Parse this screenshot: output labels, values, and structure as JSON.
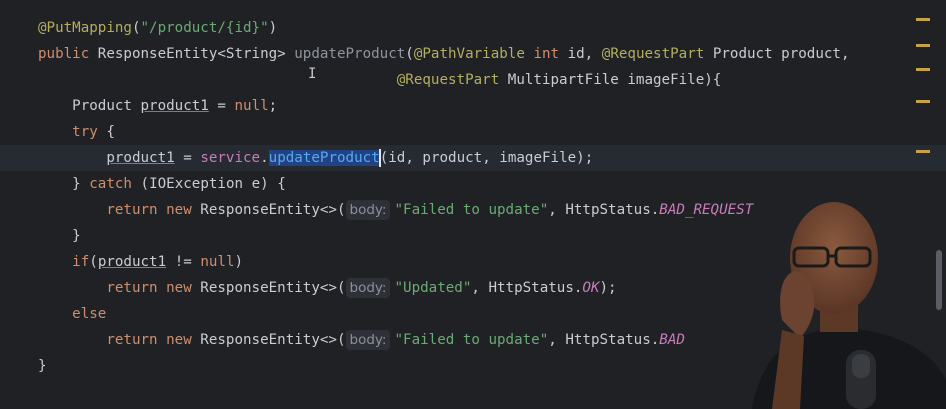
{
  "code": {
    "l1_annotation": "@PutMapping",
    "l1_open": "(",
    "l1_path": "\"/product/{id}\"",
    "l1_close": ")",
    "l2_public": "public",
    "l2_type": " ResponseEntity<String> ",
    "l2_method": "updateProduct",
    "l2_open": "(",
    "l2_anno1": "@PathVariable",
    "l2_sp1": " ",
    "l2_int": "int",
    "l2_id": " id, ",
    "l2_anno2": "@RequestPart",
    "l2_rest": " Product product,",
    "l3_indent": "                                          ",
    "l3_anno": "@RequestPart",
    "l3_rest": " MultipartFile imageFile){",
    "l5_indent": "    ",
    "l5_type": "Product ",
    "l5_var": "product1",
    "l5_eq": " = ",
    "l5_null": "null",
    "l5_semi": ";",
    "l6_indent": "    ",
    "l6_try": "try",
    "l6_brace": " {",
    "l7_indent": "        ",
    "l7_var": "product1",
    "l7_eq": " = ",
    "l7_service": "service",
    "l7_dot": ".",
    "l7_method_sel": "updateProduc",
    "l7_method_rest": "t",
    "l7_args": "(id, product, imageFile);",
    "l8_indent": "    ",
    "l8_close": "} ",
    "l8_catch": "catch",
    "l8_rest": " (IOException e) {",
    "l9_indent": "        ",
    "l9_return": "return",
    "l9_sp": " ",
    "l9_new": "new",
    "l9_type": " ResponseEntity<>(",
    "l9_hint": "body:",
    "l9_str": "\"Failed to update\"",
    "l9_comma": ", HttpStatus.",
    "l9_const": "BAD_REQUEST",
    "l10_indent": "    ",
    "l10_brace": "}",
    "l11_indent": "    ",
    "l11_if": "if",
    "l11_open": "(",
    "l11_var": "product1",
    "l11_neq": " != ",
    "l11_null": "null",
    "l11_close": ")",
    "l12_indent": "        ",
    "l12_return": "return",
    "l12_sp": " ",
    "l12_new": "new",
    "l12_type": " ResponseEntity<>(",
    "l12_hint": "body:",
    "l12_str": "\"Updated\"",
    "l12_comma": ", HttpStatus.",
    "l12_const": "OK",
    "l12_end": ");",
    "l13_indent": "    ",
    "l13_else": "else",
    "l14_indent": "        ",
    "l14_return": "return",
    "l14_sp": " ",
    "l14_new": "new",
    "l14_type": " ResponseEntity<>(",
    "l14_hint": "body:",
    "l14_str": "\"Failed to update\"",
    "l14_comma": ", HttpStatus.",
    "l14_const": "BAD",
    "l15_brace": "}"
  },
  "text_cursor": "I",
  "colors": {
    "background": "#1f2125",
    "keyword": "#cf8e6d",
    "annotation": "#b3ae60",
    "string": "#6aab73",
    "method": "#56a8f5",
    "constant": "#c77dbb",
    "selection": "#214283"
  },
  "webcam": {
    "icon": "presenter-webcam-overlay"
  }
}
